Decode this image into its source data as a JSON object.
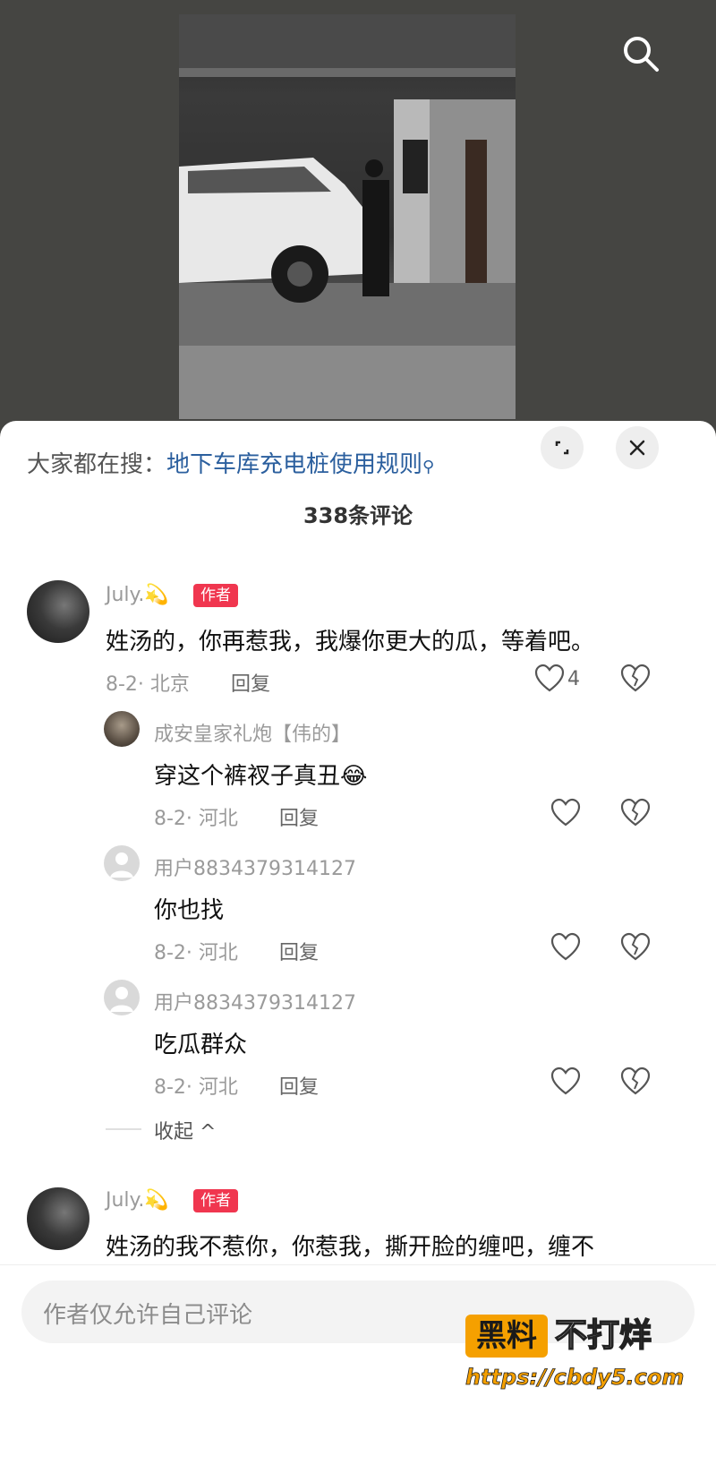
{
  "hot_search": {
    "prefix": "大家都在搜：",
    "term": "地下车库充电桩使用规则",
    "icon": "search-mini-icon"
  },
  "comments_title": "338条评论",
  "comments": [
    {
      "user": "July.💫",
      "badge": "作者",
      "text": "姓汤的，你再惹我，我爆你更大的瓜，等着吧。",
      "meta": "8-2· 北京",
      "reply_label": "回复",
      "likes": "4",
      "replies": [
        {
          "user": "成安皇家礼炮【伟的】",
          "text": "穿这个裤衩子真丑😂",
          "meta": "8-2· 河北",
          "reply_label": "回复"
        },
        {
          "user": "用户8834379314127",
          "text": "你也找",
          "meta": "8-2· 河北",
          "reply_label": "回复"
        },
        {
          "user": "用户8834379314127",
          "text": "吃瓜群众",
          "meta": "8-2· 河北",
          "reply_label": "回复"
        }
      ],
      "collapse_label": "收起 ^"
    },
    {
      "user": "July.💫",
      "badge": "作者",
      "text": "姓汤的我不惹你，你惹我，撕开脸的缠吧，缠不"
    }
  ],
  "input_placeholder": "作者仅允许自己评论",
  "watermark": {
    "box": "黑料",
    "text": "不打烊",
    "url": "https://cbdy5.com"
  },
  "colors": {
    "video_bg": "#454542",
    "link": "#2b5f9e",
    "author_badge": "#f0364f",
    "watermark_accent": "#f5a000"
  }
}
